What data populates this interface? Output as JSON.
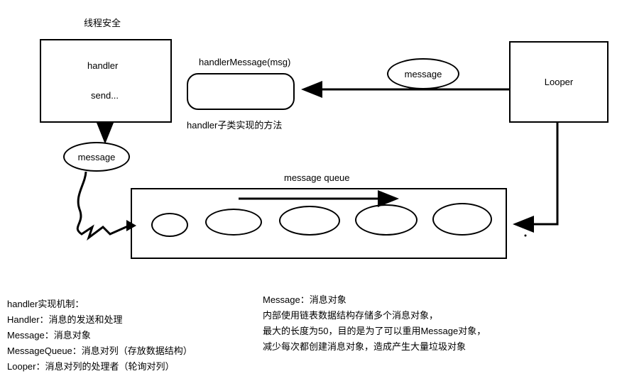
{
  "title_top": "线程安全",
  "handler_box": {
    "line1": "handler",
    "line2": "send..."
  },
  "handler_message_label": "handlerMessage(msg)",
  "handler_subclass_label": "handler子类实现的方法",
  "message_ellipse_top": "message",
  "looper_box": "Looper",
  "message_ellipse_left": "message",
  "message_queue_label": "message queue",
  "left_text": {
    "title": "handler实现机制：",
    "l1": "Handler：消息的发送和处理",
    "l2": "Message：消息对象",
    "l3": "MessageQueue：消息对列（存放数据结构）",
    "l4": "Looper：消息对列的处理者（轮询对列）"
  },
  "right_text": {
    "l1": "Message：消息对象",
    "l2": "内部使用链表数据结构存储多个消息对象，",
    "l3": "最大的长度为50，目的是为了可以重用Message对象，",
    "l4": "减少每次都创建消息对象，造成产生大量垃圾对象"
  }
}
